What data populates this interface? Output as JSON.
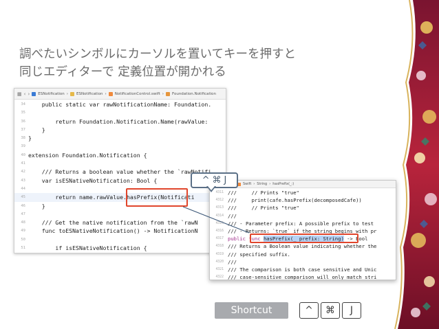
{
  "slide": {
    "title_line1": "調べたいシンボルにカーソルを置いてキーを押すと",
    "title_line2": "同じエディターで 定義位置が開かれる"
  },
  "editor": {
    "breadcrumbs": [
      "ESNotification",
      "ESNotification",
      "NotificationControl.swift",
      "Foundation.Notification"
    ],
    "lines": [
      {
        "n": "34",
        "text": "    public static var rawNotificationName: Foundation."
      },
      {
        "n": "35",
        "text": ""
      },
      {
        "n": "36",
        "text": "        return Foundation.Notification.Name(rawValue:"
      },
      {
        "n": "37",
        "text": "    }"
      },
      {
        "n": "38",
        "text": "}"
      },
      {
        "n": "39",
        "text": ""
      },
      {
        "n": "40",
        "text": "extension Foundation.Notification {"
      },
      {
        "n": "41",
        "text": ""
      },
      {
        "n": "42",
        "text": "    /// Returns a boolean value whether the `rawNotifi"
      },
      {
        "n": "43",
        "text": "    var isESNativeNotification: Bool {"
      },
      {
        "n": "44",
        "text": ""
      },
      {
        "n": "45",
        "text": "        return name.rawValue.hasPrefix(Notificati"
      },
      {
        "n": "46",
        "text": "    }"
      },
      {
        "n": "47",
        "text": ""
      },
      {
        "n": "48",
        "text": "    /// Get the native notification from the `rawN"
      },
      {
        "n": "49",
        "text": "    func toESNativeNotification() -> NotificationN"
      },
      {
        "n": "50",
        "text": ""
      },
      {
        "n": "51",
        "text": "        if isESNativeNotification {"
      },
      {
        "n": "52",
        "text": ""
      }
    ]
  },
  "definition_view": {
    "breadcrumbs": [
      "Swift",
      "String",
      "hasPrefix(_:)"
    ],
    "lines": [
      {
        "n": "4311",
        "text": "///     // Prints \"true\""
      },
      {
        "n": "4312",
        "text": "///     print(cafe.hasPrefix(decomposedCafe))"
      },
      {
        "n": "4313",
        "text": "///     // Prints \"true\""
      },
      {
        "n": "4314",
        "text": "///"
      },
      {
        "n": "4315",
        "text": "/// - Parameter prefix: A possible prefix to test"
      },
      {
        "n": "4316",
        "text": "/// - Returns: `true` if the string begins with pr"
      },
      {
        "n": "4317",
        "pre": "public func ",
        "sel": "hasPrefix(_ prefix: String)",
        "post": " -> Bool"
      },
      {
        "n": "4318",
        "text": "/// Returns a Boolean value indicating whether the"
      },
      {
        "n": "4319",
        "text": "/// specified suffix."
      },
      {
        "n": "4320",
        "text": "///"
      },
      {
        "n": "4321",
        "text": "/// The comparison is both case sensitive and Unic"
      },
      {
        "n": "4322",
        "text": "/// case-sensitive comparison will only match stri"
      }
    ]
  },
  "callout": {
    "ctrl": "^",
    "cmd": "⌘",
    "key": "J"
  },
  "footer": {
    "shortcut_label": "Shortcut",
    "keys": [
      "^",
      "⌘",
      "J"
    ]
  },
  "colors": {
    "highlight_box": "#e0452b",
    "callout_border": "#5a6f86",
    "badge_bg": "#a8aaae"
  }
}
